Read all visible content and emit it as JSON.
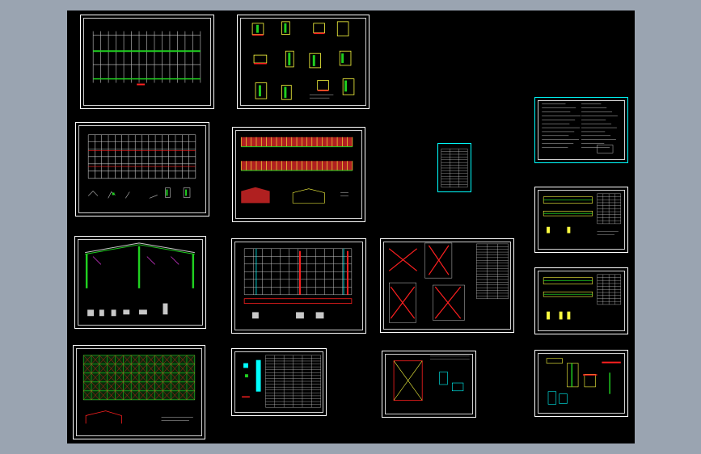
{
  "viewer": {
    "background_color": "#9aa4b1",
    "canvas_color": "#000000",
    "sheet_border_color": "#ffffff",
    "line_colors": {
      "grid": "#c8c8c8",
      "member": "#ff2020",
      "fill": "#20d020",
      "cyan": "#00ffff",
      "yellow": "#ffff40",
      "white": "#ffffff",
      "magenta": "#ff40ff"
    }
  },
  "sheets": [
    {
      "name": "sheet-foundation-plan",
      "kind": "plan-grid"
    },
    {
      "name": "sheet-node-details",
      "kind": "details"
    },
    {
      "name": "sheet-column-layout",
      "kind": "plan-grid-details"
    },
    {
      "name": "sheet-elevations",
      "kind": "elevations"
    },
    {
      "name": "sheet-portal-frame",
      "kind": "frame"
    },
    {
      "name": "sheet-roof-bracing-plan",
      "kind": "bracing-plan"
    },
    {
      "name": "sheet-bracing-details",
      "kind": "bracing-details"
    },
    {
      "name": "sheet-purlin-plan",
      "kind": "purlin-plan"
    },
    {
      "name": "sheet-material-table",
      "kind": "table"
    },
    {
      "name": "sheet-anchor-detail",
      "kind": "anchor"
    },
    {
      "name": "sheet-drawing-index",
      "kind": "index"
    },
    {
      "name": "sheet-design-notes",
      "kind": "notes"
    },
    {
      "name": "sheet-crane-beam-1",
      "kind": "beam"
    },
    {
      "name": "sheet-crane-beam-2",
      "kind": "beam"
    },
    {
      "name": "sheet-misc-details",
      "kind": "misc"
    }
  ]
}
